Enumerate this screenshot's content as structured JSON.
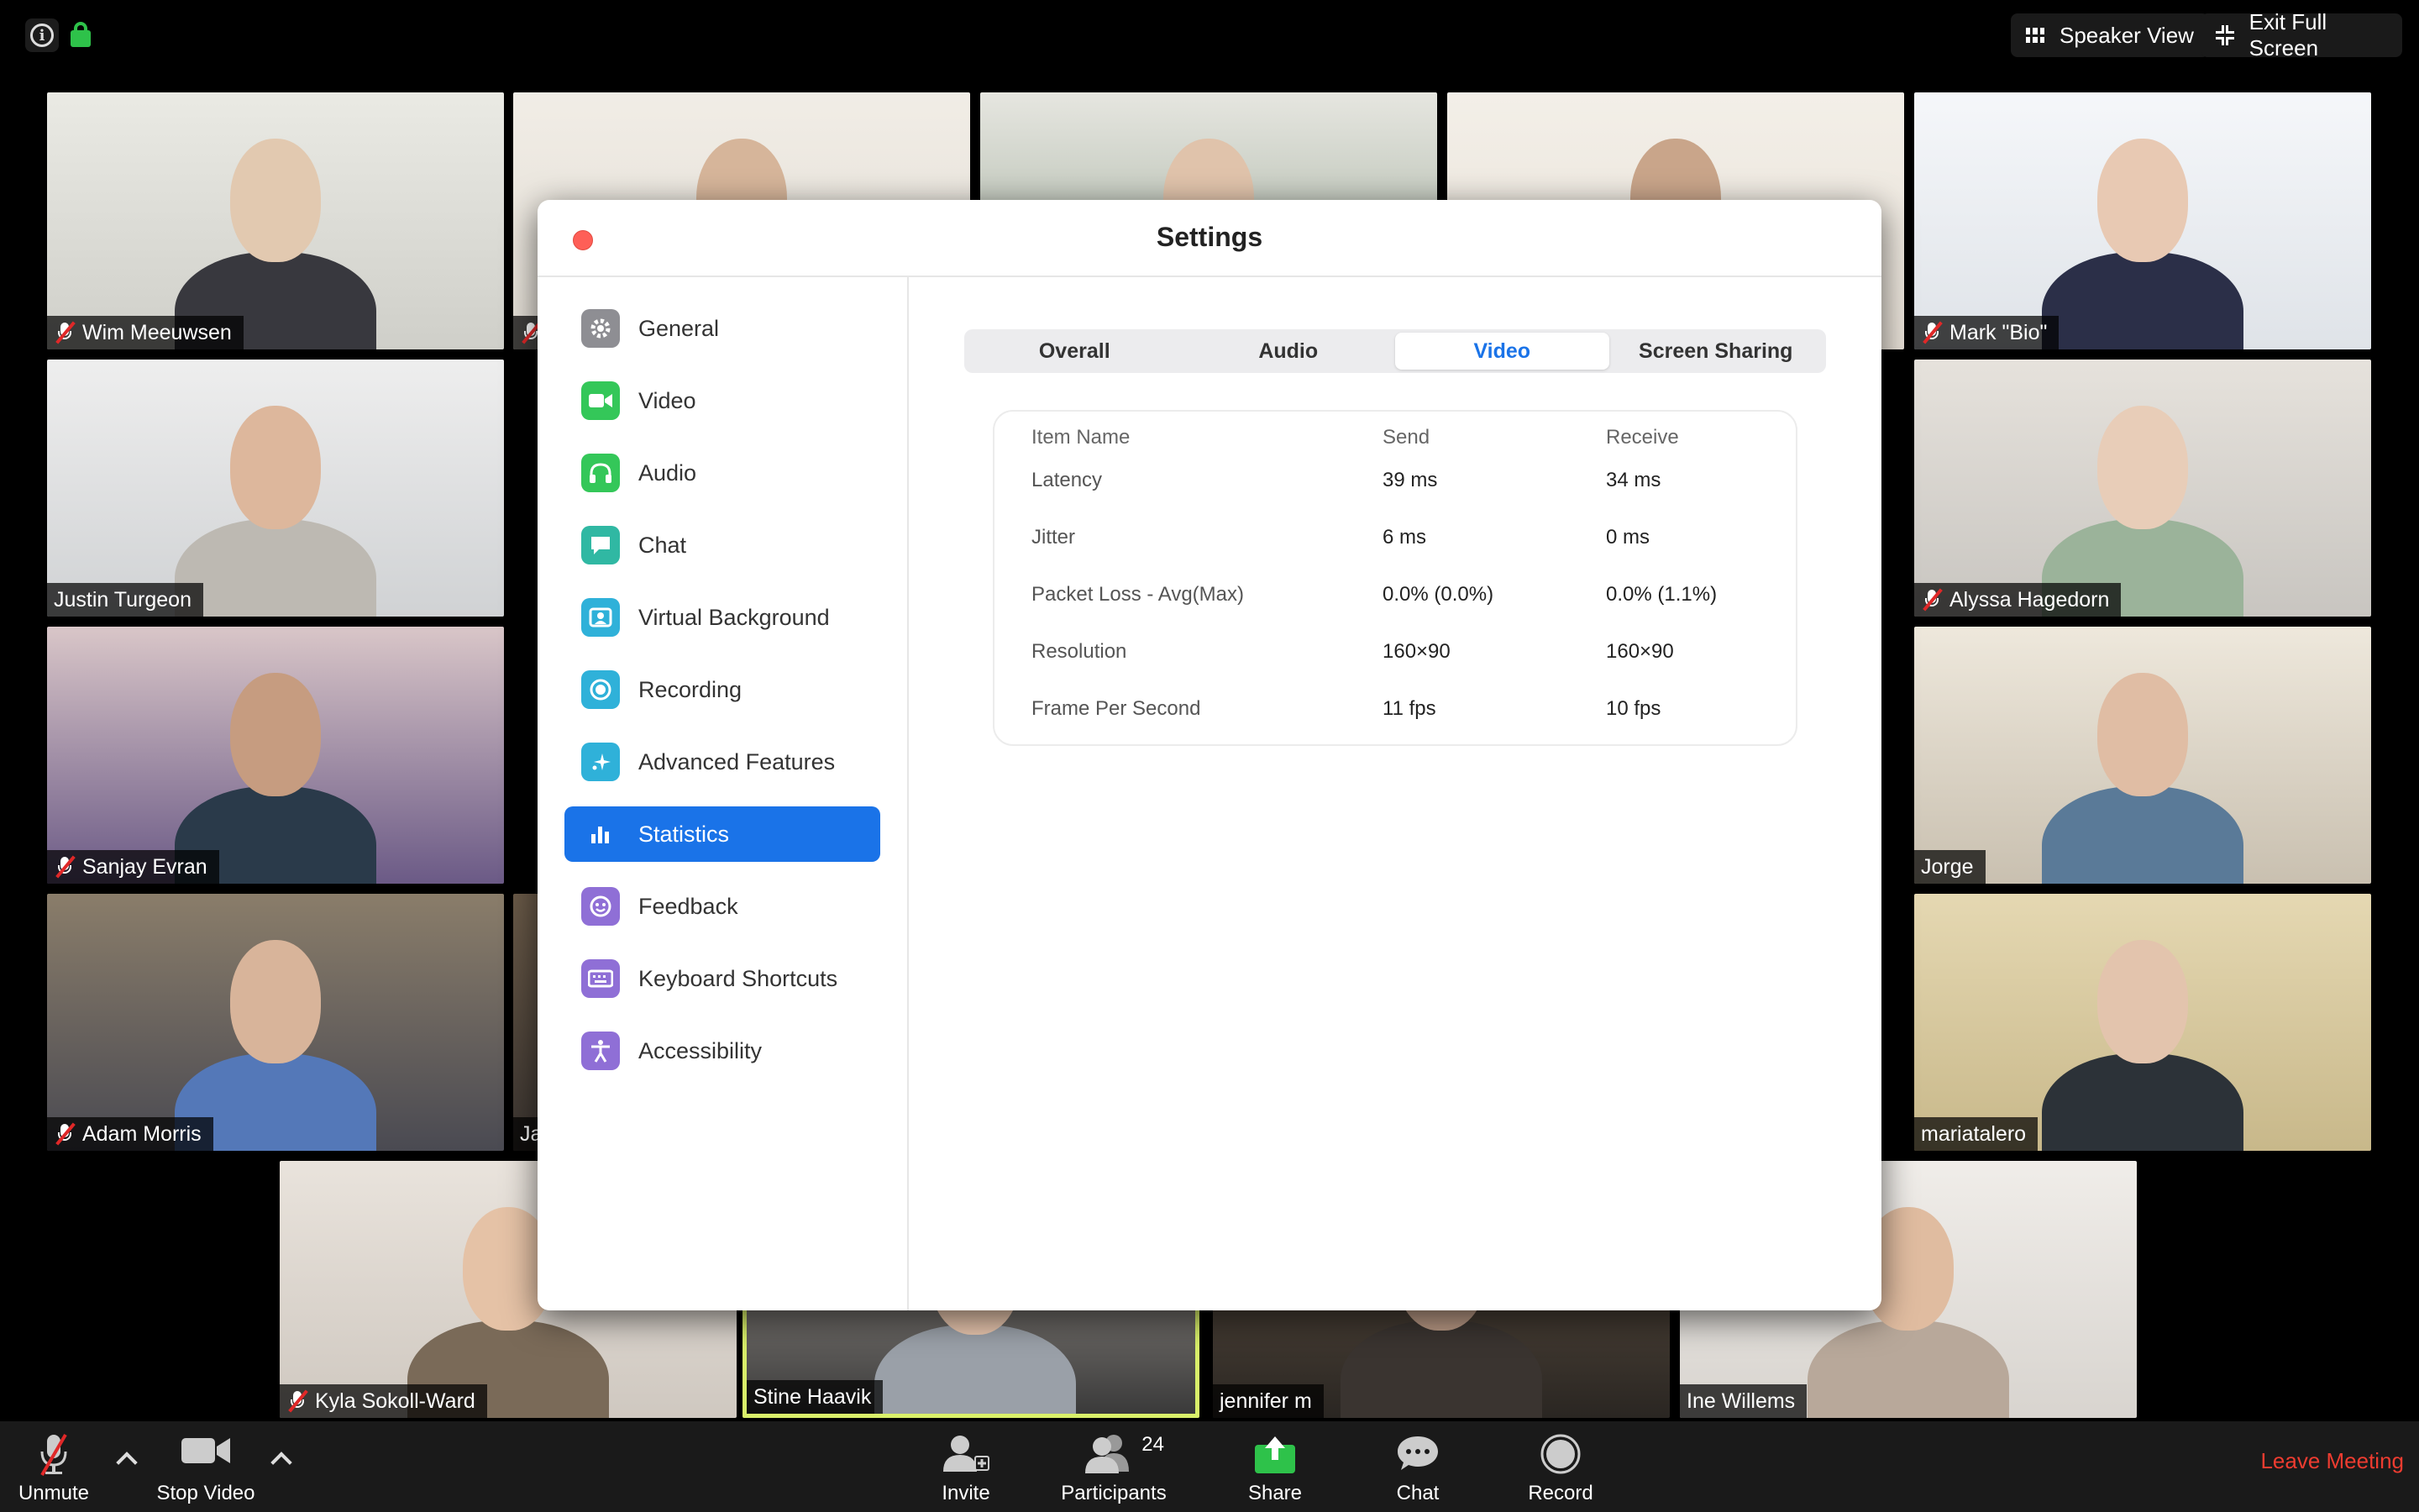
{
  "top_bar": {
    "speaker_view_label": "Speaker View",
    "exit_full_screen_label": "Exit Full Screen",
    "info_glyph": "i",
    "icons": [
      "info-icon",
      "lock-icon",
      "grid-icon",
      "exit-fullscreen-icon"
    ]
  },
  "participants_grid": {
    "tiles": [
      {
        "name": "Wim Meeuwsen",
        "muted": true
      },
      {
        "name": "",
        "muted": true
      },
      {
        "name": "",
        "muted": false
      },
      {
        "name": "",
        "muted": false
      },
      {
        "name": "Mark \"Bio\"",
        "muted": true
      },
      {
        "name": "Justin Turgeon",
        "muted": false
      },
      {
        "name": "Alyssa Hagedorn",
        "muted": true
      },
      {
        "name": "Sanjay Evran",
        "muted": true
      },
      {
        "name": "Jorge",
        "muted": false
      },
      {
        "name": "Adam Morris",
        "muted": true
      },
      {
        "name": "Ja",
        "muted": false
      },
      {
        "name": "mariatalero",
        "muted": false
      },
      {
        "name": "Kyla Sokoll-Ward",
        "muted": true
      },
      {
        "name": "Stine Haavik",
        "muted": false,
        "active_speaker": true
      },
      {
        "name": "jennifer m",
        "muted": false
      },
      {
        "name": "Ine Willems",
        "muted": false
      }
    ]
  },
  "settings": {
    "title": "Settings",
    "nav": [
      {
        "label": "General",
        "icon": "gear-icon",
        "color": "#8e8e93"
      },
      {
        "label": "Video",
        "icon": "video-camera-icon",
        "color": "#34c759"
      },
      {
        "label": "Audio",
        "icon": "headphones-icon",
        "color": "#34c759"
      },
      {
        "label": "Chat",
        "icon": "chat-bubble-icon",
        "color": "#30b8a3"
      },
      {
        "label": "Virtual Background",
        "icon": "portrait-icon",
        "color": "#2fb1d9"
      },
      {
        "label": "Recording",
        "icon": "record-icon",
        "color": "#2fb1d9"
      },
      {
        "label": "Advanced Features",
        "icon": "sparkle-icon",
        "color": "#2fb1d9"
      },
      {
        "label": "Statistics",
        "icon": "bar-chart-icon",
        "color": "#1a73e8",
        "active": true
      },
      {
        "label": "Feedback",
        "icon": "smiley-icon",
        "color": "#8f6fd6"
      },
      {
        "label": "Keyboard Shortcuts",
        "icon": "keyboard-icon",
        "color": "#8f6fd6"
      },
      {
        "label": "Accessibility",
        "icon": "accessibility-icon",
        "color": "#8f6fd6"
      }
    ],
    "tabs": [
      {
        "label": "Overall",
        "active": false
      },
      {
        "label": "Audio",
        "active": false
      },
      {
        "label": "Video",
        "active": true
      },
      {
        "label": "Screen Sharing",
        "active": false
      }
    ],
    "stats_table": {
      "headers": [
        "Item Name",
        "Send",
        "Receive"
      ],
      "rows": [
        {
          "item": "Latency",
          "send": "39 ms",
          "receive": "34 ms"
        },
        {
          "item": "Jitter",
          "send": "6 ms",
          "receive": "0 ms"
        },
        {
          "item": "Packet Loss - Avg(Max)",
          "send": "0.0% (0.0%)",
          "receive": "0.0% (1.1%)"
        },
        {
          "item": "Resolution",
          "send": "160×90",
          "receive": "160×90"
        },
        {
          "item": "Frame Per Second",
          "send": "11 fps",
          "receive": "10 fps"
        }
      ]
    }
  },
  "toolbar": {
    "unmute_label": "Unmute",
    "stop_video_label": "Stop Video",
    "invite_label": "Invite",
    "participants_label": "Participants",
    "participants_count": "24",
    "share_label": "Share",
    "chat_label": "Chat",
    "record_label": "Record",
    "leave_label": "Leave Meeting"
  },
  "colors": {
    "accent": "#1a73e8",
    "leave_red": "#ee3c30",
    "share_green": "#2ec24a",
    "active_speaker_border": "#d9f06a"
  }
}
